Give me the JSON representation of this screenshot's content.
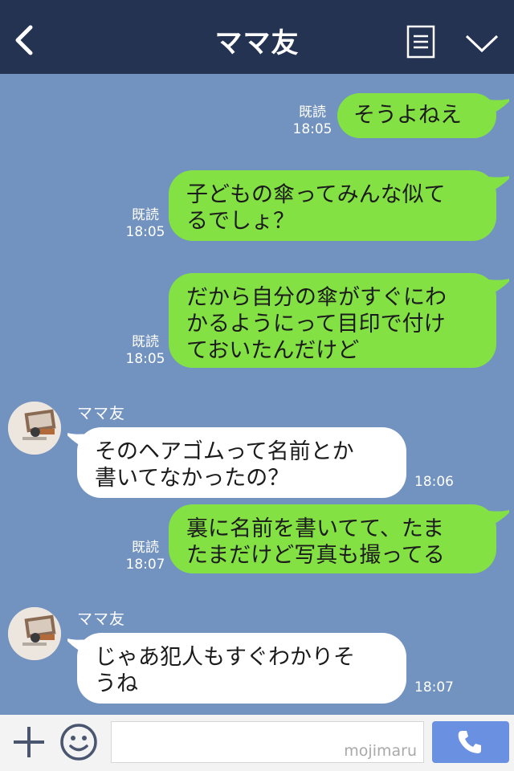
{
  "header": {
    "title": "ママ友",
    "icons": [
      "back-icon",
      "menu-icon",
      "chevron-down-icon"
    ]
  },
  "messages": [
    {
      "side": "out",
      "read": "既読",
      "time": "18:05",
      "lines": [
        "そうよねえ"
      ]
    },
    {
      "side": "out",
      "read": "既読",
      "time": "18:05",
      "lines": [
        "子どもの傘ってみんな似て",
        "るでしょ？"
      ]
    },
    {
      "side": "out",
      "read": "既読",
      "time": "18:05",
      "lines": [
        "だから自分の傘がすぐにわ",
        "かるようにって目印で付け",
        "ておいたんだけど"
      ]
    },
    {
      "side": "in",
      "sender": "ママ友",
      "time": "18:06",
      "lines": [
        "そのヘアゴムって名前とか",
        "書いてなかったの？"
      ]
    },
    {
      "side": "out",
      "read": "既読",
      "time": "18:07",
      "lines": [
        "裏に名前を書いてて、たま",
        "たまだけど写真も撮ってる"
      ]
    },
    {
      "side": "in",
      "sender": "ママ友",
      "time": "18:07",
      "lines": [
        "じゃあ犯人もすぐわかりそ",
        "うね"
      ]
    }
  ],
  "footer": {
    "watermark": "mojimaru",
    "icons": [
      "plus-icon",
      "smile-icon",
      "phone-icon"
    ]
  },
  "colors": {
    "header_bg": "#243352",
    "chat_bg": "#7292c0",
    "out_bubble": "#84e144",
    "in_bubble": "#ffffff",
    "call_button": "#6a90e2"
  }
}
